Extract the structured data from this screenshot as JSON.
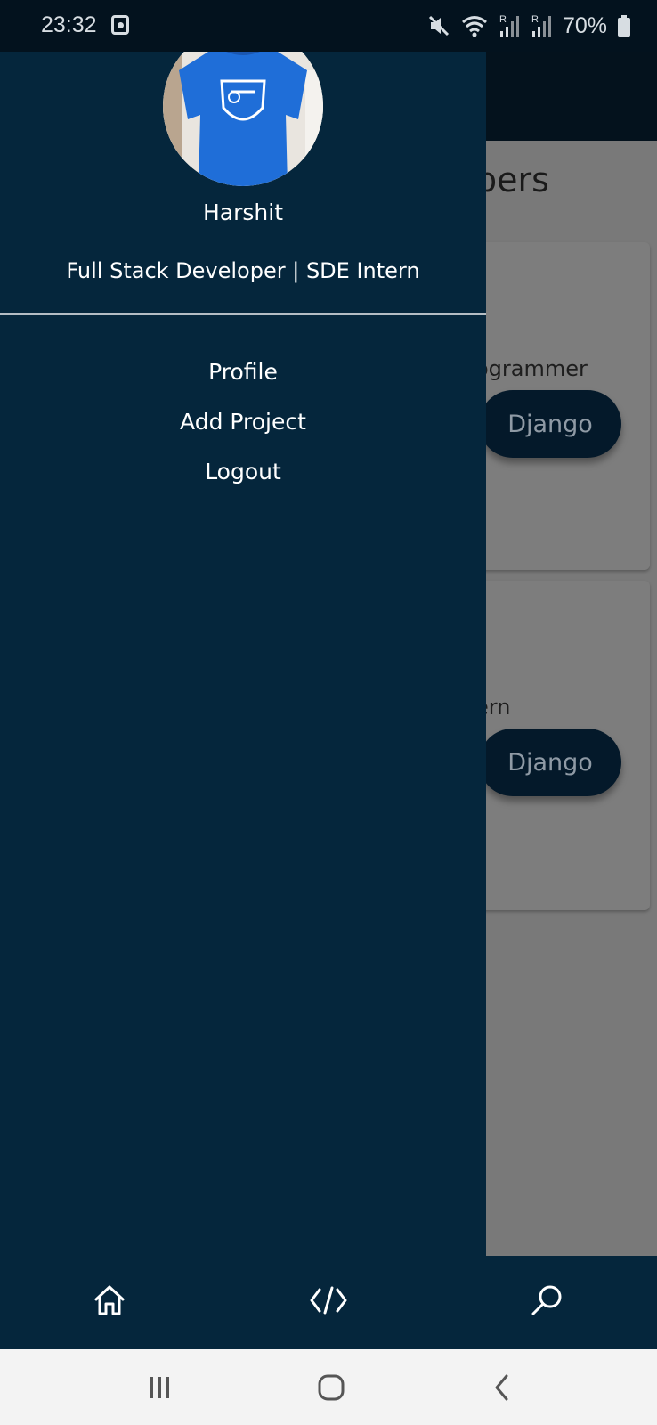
{
  "status_bar": {
    "time": "23:32",
    "battery": "70%",
    "icons": [
      "alarm-icon",
      "mute-icon",
      "wifi-icon",
      "signal-icon",
      "signal-icon",
      "battery-icon"
    ]
  },
  "background_page": {
    "heading": "pers",
    "cards": [
      {
        "role": "ogrammer",
        "tag": "Django"
      },
      {
        "role": "ern",
        "tag": "Django"
      }
    ]
  },
  "drawer": {
    "name": "Harshit",
    "role": "Full Stack Developer | SDE Intern",
    "menu": [
      {
        "label": "Profile"
      },
      {
        "label": "Add Project"
      },
      {
        "label": "Logout"
      }
    ]
  },
  "bottom_nav": [
    "home-icon",
    "code-icon",
    "search-icon"
  ],
  "system_nav": [
    "recent-apps-icon",
    "home-circle-icon",
    "back-icon"
  ],
  "colors": {
    "drawer_bg": "#05263c",
    "header_bg": "#04121d",
    "overlay_bg": "#797979",
    "pill_bg": "#04192a"
  }
}
